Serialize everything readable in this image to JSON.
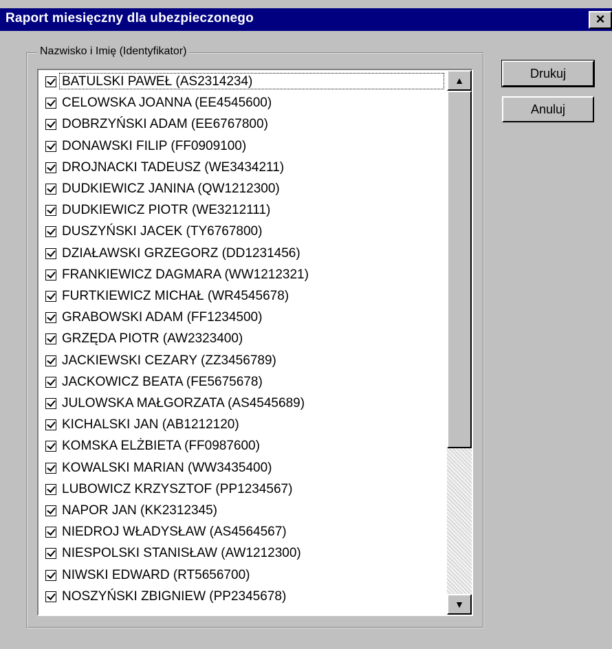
{
  "window": {
    "title": "Raport miesięczny dla ubezpieczonego",
    "close_glyph": "×"
  },
  "group": {
    "legend": "Nazwisko i Imię (Identyfikator)"
  },
  "buttons": {
    "print": "Drukuj",
    "cancel": "Anuluj"
  },
  "list": {
    "items": [
      {
        "label": "BATULSKI PAWEŁ (AS2314234)",
        "checked": true
      },
      {
        "label": "CELOWSKA JOANNA (EE4545600)",
        "checked": true
      },
      {
        "label": "DOBRZYŃSKI ADAM (EE6767800)",
        "checked": true
      },
      {
        "label": "DONAWSKI FILIP (FF0909100)",
        "checked": true
      },
      {
        "label": "DROJNACKI TADEUSZ (WE3434211)",
        "checked": true
      },
      {
        "label": "DUDKIEWICZ JANINA (QW1212300)",
        "checked": true
      },
      {
        "label": "DUDKIEWICZ PIOTR (WE3212111)",
        "checked": true
      },
      {
        "label": "DUSZYŃSKI JACEK (TY6767800)",
        "checked": true
      },
      {
        "label": "DZIAŁAWSKI GRZEGORZ (DD1231456)",
        "checked": true
      },
      {
        "label": "FRANKIEWICZ DAGMARA (WW1212321)",
        "checked": true
      },
      {
        "label": "FURTKIEWICZ MICHAŁ (WR4545678)",
        "checked": true
      },
      {
        "label": "GRABOWSKI ADAM (FF1234500)",
        "checked": true
      },
      {
        "label": "GRZĘDA PIOTR (AW2323400)",
        "checked": true
      },
      {
        "label": "JACKIEWSKI CEZARY (ZZ3456789)",
        "checked": true
      },
      {
        "label": "JACKOWICZ BEATA (FE5675678)",
        "checked": true
      },
      {
        "label": "JULOWSKA MAŁGORZATA (AS4545689)",
        "checked": true
      },
      {
        "label": "KICHALSKI JAN (AB1212120)",
        "checked": true
      },
      {
        "label": "KOMSKA ELŻBIETA (FF0987600)",
        "checked": true
      },
      {
        "label": "KOWALSKI MARIAN (WW3435400)",
        "checked": true
      },
      {
        "label": "LUBOWICZ KRZYSZTOF (PP1234567)",
        "checked": true
      },
      {
        "label": "NAPOR JAN (KK2312345)",
        "checked": true
      },
      {
        "label": "NIEDROJ WŁADYSŁAW (AS4564567)",
        "checked": true
      },
      {
        "label": "NIESPOLSKI STANISŁAW (AW1212300)",
        "checked": true
      },
      {
        "label": "NIWSKI EDWARD (RT5656700)",
        "checked": true
      },
      {
        "label": "NOSZYŃSKI ZBIGNIEW (PP2345678)",
        "checked": true
      }
    ]
  },
  "scrollbar": {
    "up_icon": "triangle-up-icon",
    "down_icon": "triangle-down-icon"
  },
  "colors": {
    "titlebar": "#000080",
    "face": "#c0c0c0"
  }
}
